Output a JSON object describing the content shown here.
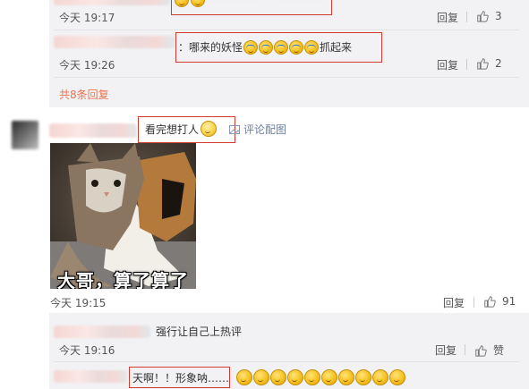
{
  "thread1": {
    "partial_row": {
      "time": "今天 19:17",
      "reply": "回复",
      "likes": "3"
    },
    "row2": {
      "prefix": "：哪来的妖怪",
      "suffix": "抓起来",
      "time": "今天 19:26",
      "reply": "回复",
      "likes": "2",
      "emoji_icon": "crying-laughing-emoji-icon",
      "emoji_count": 5
    },
    "more_link": "共8条回复"
  },
  "comment": {
    "text": "看完想打人",
    "emoji_icon": "hug-emoji-icon",
    "image_link": "评论配图",
    "image_caption": "大哥，算了算了",
    "time": "今天 19:15",
    "reply": "回复",
    "likes": "91"
  },
  "thread2": {
    "row1": {
      "text": "强行让自己上热评",
      "time": "今天 19:16",
      "reply": "回复",
      "likes": "赞"
    },
    "row2": {
      "text": "天啊！！形象呐……",
      "emoji_count": 10
    }
  },
  "colors": {
    "highlight": "#d23b2f",
    "link": "#eb7350",
    "subpanel": "#f2f2f5"
  }
}
